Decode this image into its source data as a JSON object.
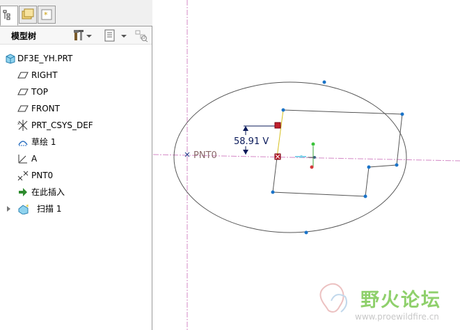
{
  "panel": {
    "title": "模型树",
    "tabs": [
      {
        "icon": "model-tree-tab-icon"
      },
      {
        "icon": "folder-browser-tab-icon"
      },
      {
        "icon": "favorites-tab-icon"
      }
    ],
    "toolbar_icons": [
      "settings-tools-icon",
      "show-list-icon",
      "filter-icon"
    ]
  },
  "tree": {
    "items": [
      {
        "label": "DF3E_YH.PRT",
        "icon": "part-icon"
      },
      {
        "label": "RIGHT",
        "icon": "datum-plane-icon"
      },
      {
        "label": "TOP",
        "icon": "datum-plane-icon"
      },
      {
        "label": "FRONT",
        "icon": "datum-plane-icon"
      },
      {
        "label": "PRT_CSYS_DEF",
        "icon": "csys-icon"
      },
      {
        "label": "草绘 1",
        "icon": "sketch-icon"
      },
      {
        "label": "A",
        "icon": "datum-axis-icon"
      },
      {
        "label": "PNT0",
        "icon": "datum-point-icon"
      },
      {
        "label": "在此插入",
        "icon": "insert-here-arrow-icon"
      },
      {
        "label": "扫描 1",
        "icon": "sweep-icon"
      }
    ]
  },
  "canvas": {
    "dimension_label": "58.91 V",
    "point_label": "PNT0",
    "colors": {
      "sketch_line": "#555555",
      "vertex": "#1a73c8",
      "datum": "#d488c6",
      "dimension": "#0a1a5a",
      "handle": "#c0202e",
      "yellow_line": "#d6c020"
    }
  },
  "watermark": {
    "text": "野火论坛",
    "url": "www.proewildfire.cn"
  }
}
